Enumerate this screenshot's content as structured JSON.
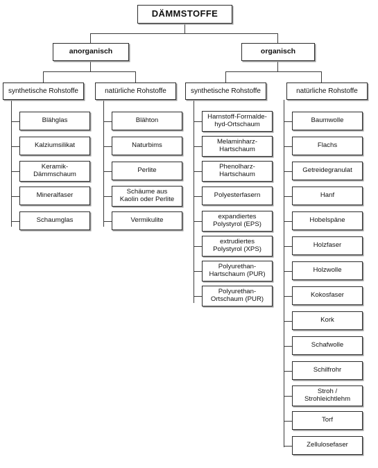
{
  "diagram": {
    "type": "hierarchy-tree",
    "language": "de",
    "root": {
      "label": "DÄMMSTOFFE"
    },
    "level2": [
      {
        "id": "anorganisch",
        "label": "anorganisch"
      },
      {
        "id": "organisch",
        "label": "organisch"
      }
    ],
    "level3": [
      {
        "id": "anorg-synth",
        "parent": "anorganisch",
        "label": "synthetische Rohstoffe"
      },
      {
        "id": "anorg-nat",
        "parent": "anorganisch",
        "label": "natürliche Rohstoffe"
      },
      {
        "id": "org-synth",
        "parent": "organisch",
        "label": "synthetische Rohstoffe"
      },
      {
        "id": "org-nat",
        "parent": "organisch",
        "label": "natürliche Rohstoffe"
      }
    ],
    "columns": [
      {
        "id": "anorg-synth",
        "leaves": [
          "Blähglas",
          "Kalziumsilikat",
          "Keramik-\nDämmschaum",
          "Mineralfaser",
          "Schaumglas"
        ]
      },
      {
        "id": "anorg-nat",
        "leaves": [
          "Blähton",
          "Naturbims",
          "Perlite",
          "Schäume aus\nKaolin oder Perlite",
          "Vermikulite"
        ]
      },
      {
        "id": "org-synth",
        "leaves": [
          "Harnstoff-Formalde-\nhyd-Ortschaum",
          "Melaminharz-\nHartschaum",
          "Phenolharz-\nHartschaum",
          "Polyesterfasern",
          "expandiertes\nPolystyrol (EPS)",
          "extrudiertes\nPolystyrol (XPS)",
          "Polyurethan-\nHartschaum (PUR)",
          "Polyurethan-\nOrtschaum (PUR)"
        ]
      },
      {
        "id": "org-nat",
        "leaves": [
          "Baumwolle",
          "Flachs",
          "Getreidegranulat",
          "Hanf",
          "Hobelspäne",
          "Holzfaser",
          "Holzwolle",
          "Kokosfaser",
          "Kork",
          "Schafwolle",
          "Schilfrohr",
          "Stroh /\nStrohleichtlehm",
          "Torf",
          "Zellulosefaser"
        ]
      }
    ],
    "colors": {
      "background": "#ffffff",
      "box_border": "#2b2b2b",
      "box_fill": "#ffffff",
      "connector": "#3a3a3a",
      "shadow": "#9a9a9a",
      "text": "#111111"
    }
  }
}
